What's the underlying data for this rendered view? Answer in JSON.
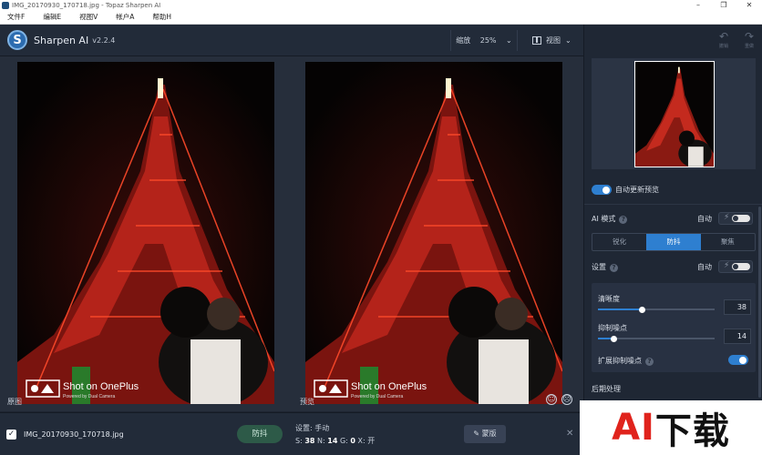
{
  "window": {
    "title": "IMG_20170930_170718.jpg - Topaz Sharpen AI",
    "controls": [
      "–",
      "❐",
      "✕"
    ]
  },
  "menubar": {
    "items": [
      "文件F",
      "编辑E",
      "视图V",
      "帐户A",
      "帮助H"
    ]
  },
  "header": {
    "logo_glyph": "S",
    "app_name": "Sharpen AI",
    "version": "v2.2.4",
    "zoom_label": "缩放",
    "zoom_value": "25%",
    "view_label": "视图"
  },
  "canvas": {
    "left_label": "原图",
    "right_label": "预览",
    "photo_caption": "Shot on OnePlus",
    "photo_subcaption": "Powered by Dual Camera",
    "feedback": [
      "☺",
      "☹"
    ]
  },
  "bottombar": {
    "checkbox_checked": true,
    "filename": "IMG_20170930_170718.jpg",
    "mode_button": "防抖",
    "settings_line": "设置: 手动",
    "stats": {
      "s_label": "S:",
      "s": "38",
      "n_label": "N:",
      "n": "14",
      "g_label": "G:",
      "g": "0",
      "x_label": "X:",
      "x": "开"
    },
    "mask_button": "蒙版",
    "close": "✕"
  },
  "sidebar": {
    "undo_label": "撤销",
    "redo_label": "重做",
    "auto_update_preview": "自动更新预览",
    "auto_update_on": true,
    "ai_mode_label": "AI 模式",
    "auto_label": "自动",
    "modes": [
      "锐化",
      "防抖",
      "聚焦"
    ],
    "active_mode": "防抖",
    "settings_label": "设置",
    "sliders": [
      {
        "label": "清晰度",
        "value": 38,
        "fraction": 0.38
      },
      {
        "label": "抑制噪点",
        "value": 14,
        "fraction": 0.14
      }
    ],
    "extended_denoise": "扩展抑制噪点",
    "extended_denoise_on": true,
    "post_processing": "后期处理"
  },
  "watermark": {
    "part_a": "AI",
    "part_b": "下载"
  },
  "colors": {
    "accent": "#2e7fd0",
    "panel": "#1f2734",
    "denoise_button": "#2d5a48"
  }
}
